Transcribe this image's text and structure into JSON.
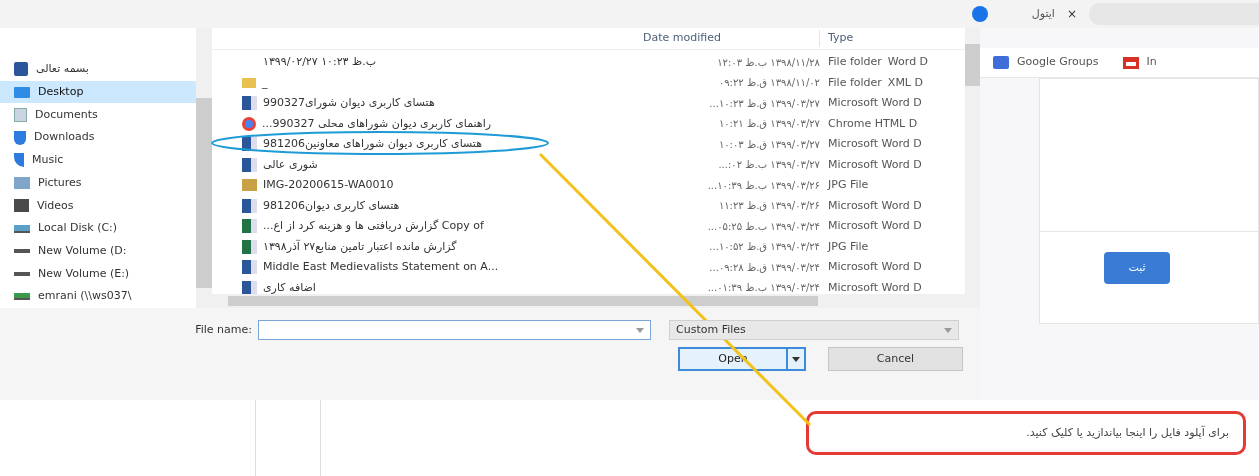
{
  "browser": {
    "tab_title": "ایتول",
    "tab_close": "×",
    "groups_bookmark": {
      "label": "Google Groups",
      "kind": "groups"
    },
    "gmail_bookmark": {
      "label": "In",
      "kind": "gmail"
    },
    "form_button": "ثبت",
    "upload_hint": "برای آپلود فایل را اینجا بیاندازید یا کلیک کنید."
  },
  "dialog": {
    "nav_items": [
      {
        "label": "بسمه تعالی",
        "kind": "word",
        "selected": false
      },
      {
        "label": "Desktop",
        "kind": "desktop",
        "selected": true
      },
      {
        "label": "Documents",
        "kind": "documents",
        "selected": false
      },
      {
        "label": "Downloads",
        "kind": "downloads",
        "selected": false
      },
      {
        "label": "Music",
        "kind": "music",
        "selected": false
      },
      {
        "label": "Pictures",
        "kind": "pictures",
        "selected": false
      },
      {
        "label": "Videos",
        "kind": "videos",
        "selected": false
      },
      {
        "label": "Local Disk (C:)",
        "kind": "disk",
        "selected": false
      },
      {
        "label": "New Volume (D:",
        "kind": "drive",
        "selected": false
      },
      {
        "label": "New Volume (E:)",
        "kind": "drive",
        "selected": false
      },
      {
        "label": "emrani (\\\\ws037\\",
        "kind": "network",
        "selected": false
      }
    ],
    "date_column": "Date modified",
    "type_column": "Type",
    "files": [
      {
        "name": "۱۳۹۹/۰۲/۲۷ ب.ظ ۱۰:۲۳",
        "kind": "none",
        "date": "۱۳۹۸/۱۱/۲۸ ب.ظ ۱۲:۰۳",
        "type": "File folder",
        "column_4": "Word D"
      },
      {
        "name": "_",
        "kind": "folder",
        "date": "۱۳۹۸/۱۱/۰۲ ق.ظ ۰۹:۲۲",
        "type": "File folder",
        "column_4": "XML D"
      },
      {
        "name": "990327هتسای کاربری دیوان شورای",
        "kind": "word",
        "date": "۱۳۹۹/۰۳/۲۷ ق.ظ ۱۰:۲۳...",
        "type": "Microsoft Word D"
      },
      {
        "name": "...راهنمای کاربری دیوان شوراهای محلی 990327",
        "kind": "chrome",
        "date": "۱۳۹۹/۰۳/۲۷ ق.ظ ۱۰:۲۱",
        "type": "Chrome HTML D"
      },
      {
        "name": "981206هتسای کاربری دیوان شوراهای معاونین",
        "kind": "word",
        "date": "۱۳۹۹/۰۳/۲۷ ق.ظ ۱۰:۰۳",
        "type": "Microsoft Word D"
      },
      {
        "name": "شوری عالی",
        "kind": "word",
        "date": "۱۳۹۹/۰۳/۲۷ ب.ظ ۰۲:...",
        "type": "Microsoft Word D"
      },
      {
        "name": "IMG-20200615-WA0010",
        "kind": "jpg",
        "date": "۱۳۹۹/۰۳/۲۶ ب.ظ ۱۰:۳۹...",
        "type": "JPG File"
      },
      {
        "name": "981206هتسای کاربری دیوان",
        "kind": "word",
        "date": "۱۳۹۹/۰۳/۲۶ ق.ظ ۱۱:۲۳",
        "type": "Microsoft Word D"
      },
      {
        "name": "...گزارش دریافتی ها و هزینه کرد از اع Copy of",
        "kind": "excel",
        "date": "۱۳۹۹/۰۳/۲۴ ب.ظ ۰۵:۲۵...",
        "type": "Microsoft Word D"
      },
      {
        "name": "گزارش مانده اعتبار تامین منابع۲۷ آذر۱۳۹۸",
        "kind": "excel",
        "date": "۱۳۹۹/۰۳/۲۴ ق.ظ ۱۰:۵۲...",
        "type": "JPG File"
      },
      {
        "name": "Middle East Medievalists Statement on A...",
        "kind": "word",
        "date": "۱۳۹۹/۰۳/۲۴ ق.ظ ۰۹:۲۸...",
        "type": "Microsoft Word D"
      },
      {
        "name": "اضافه کاری",
        "kind": "word",
        "date": "۱۳۹۹/۰۳/۲۴ ب.ظ ۰۱:۳۹...",
        "type": "Microsoft Word D"
      }
    ],
    "file_name_label": "File name:",
    "filter": "Custom Files",
    "open_button": "Open",
    "cancel_button": "Cancel"
  }
}
